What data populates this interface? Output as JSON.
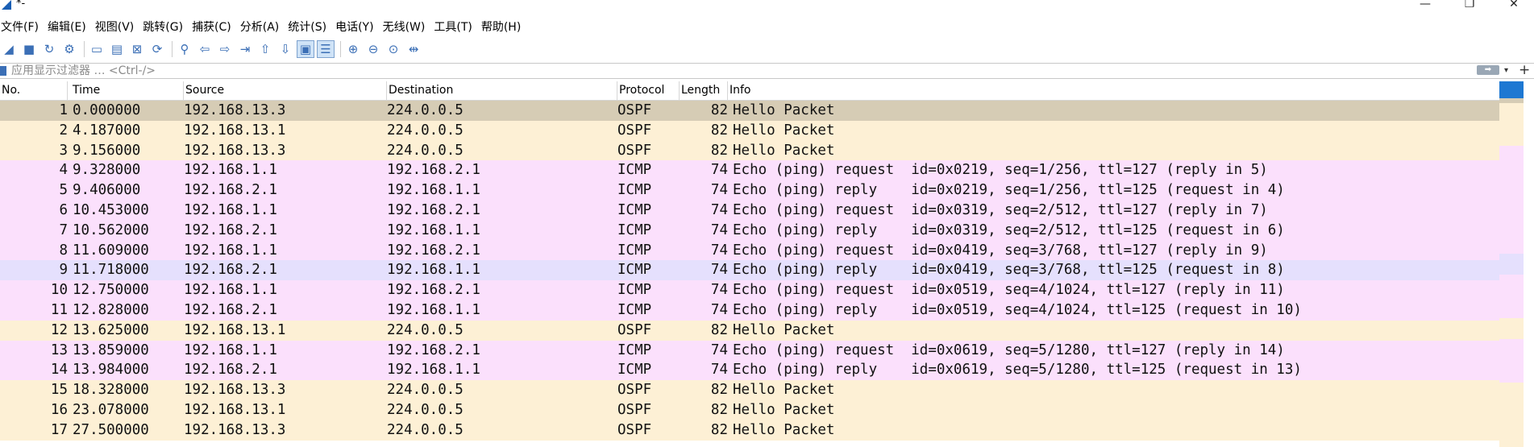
{
  "window": {
    "title": "*-",
    "minimize": "—",
    "restore": "❐",
    "close": "✕"
  },
  "menubar": [
    "文件(F)",
    "编辑(E)",
    "视图(V)",
    "跳转(G)",
    "捕获(C)",
    "分析(A)",
    "统计(S)",
    "电话(Y)",
    "无线(W)",
    "工具(T)",
    "帮助(H)"
  ],
  "toolbar": {
    "icons": [
      "shark-fin-start-icon",
      "stop-capture-icon",
      "restart-capture-icon",
      "capture-options-icon",
      "open-file-icon",
      "save-file-icon",
      "close-file-icon",
      "reload-icon",
      "find-packet-icon",
      "go-back-icon",
      "go-forward-icon",
      "go-to-packet-icon",
      "go-first-icon",
      "go-last-icon",
      "autoscroll-icon",
      "colorize-icon",
      "zoom-in-icon",
      "zoom-out-icon",
      "zoom-normal-icon",
      "resize-columns-icon"
    ]
  },
  "filter": {
    "placeholder": "应用显示过滤器 … <Ctrl-/>"
  },
  "columns": [
    "No.",
    "Time",
    "Source",
    "Destination",
    "Protocol",
    "Length",
    "Info"
  ],
  "colors": {
    "ospf": "#fdf0d5",
    "icmp": "#fbe0fc",
    "first_selected": "#d6ccb5",
    "highlight": "#e5e0fd",
    "accent": "#1e78d2"
  },
  "packets": [
    {
      "no": "1",
      "time": "0.000000",
      "src": "192.168.13.3",
      "dst": "224.0.0.5",
      "proto": "OSPF",
      "len": "82",
      "info": "Hello Packet",
      "kind": "first_selected"
    },
    {
      "no": "2",
      "time": "4.187000",
      "src": "192.168.13.1",
      "dst": "224.0.0.5",
      "proto": "OSPF",
      "len": "82",
      "info": "Hello Packet",
      "kind": "ospf"
    },
    {
      "no": "3",
      "time": "9.156000",
      "src": "192.168.13.3",
      "dst": "224.0.0.5",
      "proto": "OSPF",
      "len": "82",
      "info": "Hello Packet",
      "kind": "ospf"
    },
    {
      "no": "4",
      "time": "9.328000",
      "src": "192.168.1.1",
      "dst": "192.168.2.1",
      "proto": "ICMP",
      "len": "74",
      "info": "Echo (ping) request  id=0x0219, seq=1/256, ttl=127 (reply in 5)",
      "kind": "icmp"
    },
    {
      "no": "5",
      "time": "9.406000",
      "src": "192.168.2.1",
      "dst": "192.168.1.1",
      "proto": "ICMP",
      "len": "74",
      "info": "Echo (ping) reply    id=0x0219, seq=1/256, ttl=125 (request in 4)",
      "kind": "icmp"
    },
    {
      "no": "6",
      "time": "10.453000",
      "src": "192.168.1.1",
      "dst": "192.168.2.1",
      "proto": "ICMP",
      "len": "74",
      "info": "Echo (ping) request  id=0x0319, seq=2/512, ttl=127 (reply in 7)",
      "kind": "icmp"
    },
    {
      "no": "7",
      "time": "10.562000",
      "src": "192.168.2.1",
      "dst": "192.168.1.1",
      "proto": "ICMP",
      "len": "74",
      "info": "Echo (ping) reply    id=0x0319, seq=2/512, ttl=125 (request in 6)",
      "kind": "icmp"
    },
    {
      "no": "8",
      "time": "11.609000",
      "src": "192.168.1.1",
      "dst": "192.168.2.1",
      "proto": "ICMP",
      "len": "74",
      "info": "Echo (ping) request  id=0x0419, seq=3/768, ttl=127 (reply in 9)",
      "kind": "icmp"
    },
    {
      "no": "9",
      "time": "11.718000",
      "src": "192.168.2.1",
      "dst": "192.168.1.1",
      "proto": "ICMP",
      "len": "74",
      "info": "Echo (ping) reply    id=0x0419, seq=3/768, ttl=125 (request in 8)",
      "kind": "highlight"
    },
    {
      "no": "10",
      "time": "12.750000",
      "src": "192.168.1.1",
      "dst": "192.168.2.1",
      "proto": "ICMP",
      "len": "74",
      "info": "Echo (ping) request  id=0x0519, seq=4/1024, ttl=127 (reply in 11)",
      "kind": "icmp"
    },
    {
      "no": "11",
      "time": "12.828000",
      "src": "192.168.2.1",
      "dst": "192.168.1.1",
      "proto": "ICMP",
      "len": "74",
      "info": "Echo (ping) reply    id=0x0519, seq=4/1024, ttl=125 (request in 10)",
      "kind": "icmp"
    },
    {
      "no": "12",
      "time": "13.625000",
      "src": "192.168.13.1",
      "dst": "224.0.0.5",
      "proto": "OSPF",
      "len": "82",
      "info": "Hello Packet",
      "kind": "ospf"
    },
    {
      "no": "13",
      "time": "13.859000",
      "src": "192.168.1.1",
      "dst": "192.168.2.1",
      "proto": "ICMP",
      "len": "74",
      "info": "Echo (ping) request  id=0x0619, seq=5/1280, ttl=127 (reply in 14)",
      "kind": "icmp"
    },
    {
      "no": "14",
      "time": "13.984000",
      "src": "192.168.2.1",
      "dst": "192.168.1.1",
      "proto": "ICMP",
      "len": "74",
      "info": "Echo (ping) reply    id=0x0619, seq=5/1280, ttl=125 (request in 13)",
      "kind": "icmp"
    },
    {
      "no": "15",
      "time": "18.328000",
      "src": "192.168.13.3",
      "dst": "224.0.0.5",
      "proto": "OSPF",
      "len": "82",
      "info": "Hello Packet",
      "kind": "ospf"
    },
    {
      "no": "16",
      "time": "23.078000",
      "src": "192.168.13.1",
      "dst": "224.0.0.5",
      "proto": "OSPF",
      "len": "82",
      "info": "Hello Packet",
      "kind": "ospf"
    },
    {
      "no": "17",
      "time": "27.500000",
      "src": "192.168.13.3",
      "dst": "224.0.0.5",
      "proto": "OSPF",
      "len": "82",
      "info": "Hello Packet",
      "kind": "ospf"
    }
  ]
}
